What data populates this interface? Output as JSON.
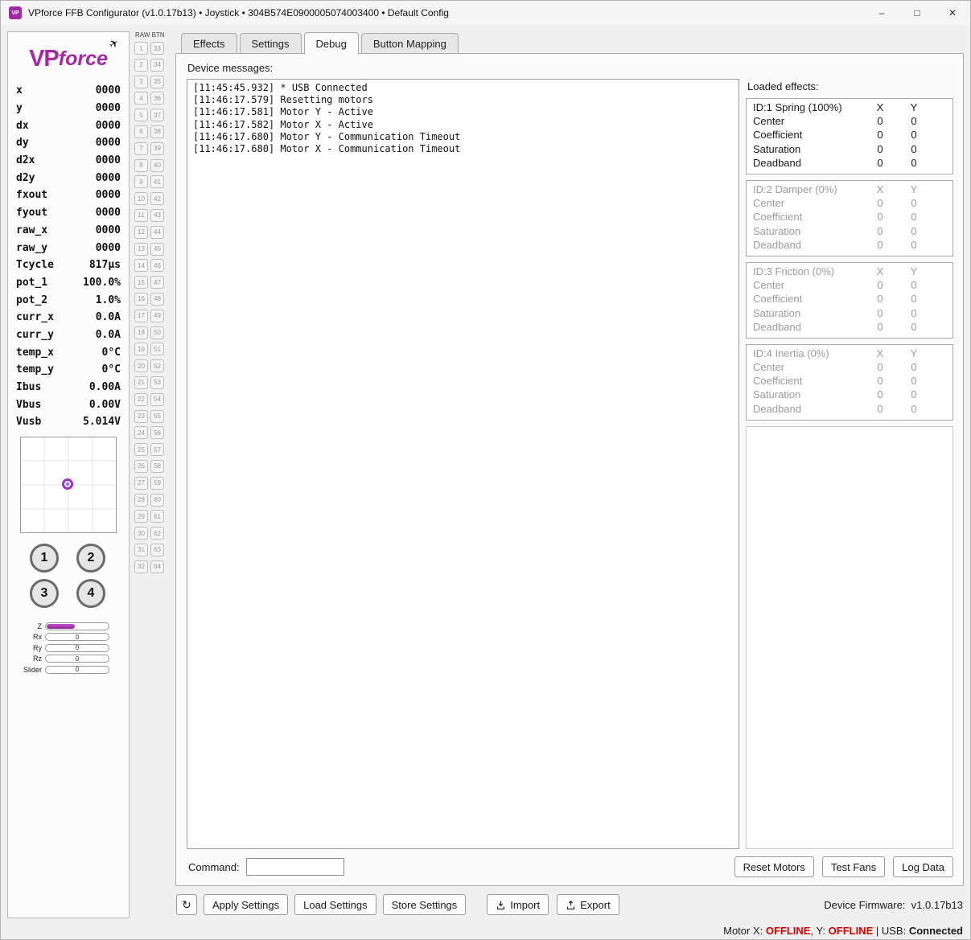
{
  "window": {
    "icon_text": "VP",
    "title": "VPforce FFB Configurator (v1.0.17b13) • Joystick • 304B574E0900005074003400 • Default Config",
    "controls": {
      "minimize": "–",
      "maximize": "□",
      "close": "✕"
    }
  },
  "sidebar": {
    "logo": {
      "vp": "VP",
      "force": "force",
      "plane": "✈"
    },
    "telemetry": [
      {
        "label": "x",
        "value": "0000"
      },
      {
        "label": "y",
        "value": "0000"
      },
      {
        "label": "dx",
        "value": "0000"
      },
      {
        "label": "dy",
        "value": "0000"
      },
      {
        "label": "d2x",
        "value": "0000"
      },
      {
        "label": "d2y",
        "value": "0000"
      },
      {
        "label": "fxout",
        "value": "0000"
      },
      {
        "label": "fyout",
        "value": "0000"
      },
      {
        "label": "raw_x",
        "value": "0000"
      },
      {
        "label": "raw_y",
        "value": "0000"
      },
      {
        "label": "Tcycle",
        "value": "817µs"
      },
      {
        "label": "pot_1",
        "value": "100.0%"
      },
      {
        "label": "pot_2",
        "value": "1.0%"
      },
      {
        "label": "curr_x",
        "value": "0.0A"
      },
      {
        "label": "curr_y",
        "value": "0.0A"
      },
      {
        "label": "temp_x",
        "value": "0°C"
      },
      {
        "label": "temp_y",
        "value": "0°C"
      },
      {
        "label": "Ibus",
        "value": "0.00A"
      },
      {
        "label": "Vbus",
        "value": "0.00V"
      },
      {
        "label": "Vusb",
        "value": "5.014V"
      }
    ],
    "hat_buttons": [
      "1",
      "2",
      "3",
      "4"
    ],
    "axes": [
      {
        "label": "Z",
        "value": "",
        "fill_percent": 45
      },
      {
        "label": "Rx",
        "value": "0",
        "fill_percent": 0
      },
      {
        "label": "Ry",
        "value": "0",
        "fill_percent": 0
      },
      {
        "label": "Rz",
        "value": "0",
        "fill_percent": 0
      },
      {
        "label": "Slider",
        "value": "0",
        "fill_percent": 0
      }
    ]
  },
  "raw_btn": {
    "header": "RAW BTN",
    "count": 64
  },
  "tabs": [
    {
      "label": "Effects",
      "active": false
    },
    {
      "label": "Settings",
      "active": false
    },
    {
      "label": "Debug",
      "active": true
    },
    {
      "label": "Button Mapping",
      "active": false
    }
  ],
  "debug": {
    "device_messages_label": "Device messages:",
    "messages": [
      "[11:45:45.932] * USB Connected",
      "[11:46:17.579] Resetting motors",
      "[11:46:17.581] Motor Y - Active",
      "[11:46:17.582] Motor X - Active",
      "[11:46:17.680] Motor Y - Communication Timeout",
      "[11:46:17.680] Motor X - Communication Timeout"
    ],
    "command_label": "Command:",
    "command_value": "",
    "loaded_effects_label": "Loaded effects:",
    "effect_columns": [
      "X",
      "Y"
    ],
    "effects": [
      {
        "title": "ID:1 Spring (100%)",
        "active": true,
        "rows": [
          {
            "name": "Center",
            "x": "0",
            "y": "0"
          },
          {
            "name": "Coefficient",
            "x": "0",
            "y": "0"
          },
          {
            "name": "Saturation",
            "x": "0",
            "y": "0"
          },
          {
            "name": "Deadband",
            "x": "0",
            "y": "0"
          }
        ]
      },
      {
        "title": "ID:2 Damper (0%)",
        "active": false,
        "rows": [
          {
            "name": "Center",
            "x": "0",
            "y": "0"
          },
          {
            "name": "Coefficient",
            "x": "0",
            "y": "0"
          },
          {
            "name": "Saturation",
            "x": "0",
            "y": "0"
          },
          {
            "name": "Deadband",
            "x": "0",
            "y": "0"
          }
        ]
      },
      {
        "title": "ID:3 Friction (0%)",
        "active": false,
        "rows": [
          {
            "name": "Center",
            "x": "0",
            "y": "0"
          },
          {
            "name": "Coefficient",
            "x": "0",
            "y": "0"
          },
          {
            "name": "Saturation",
            "x": "0",
            "y": "0"
          },
          {
            "name": "Deadband",
            "x": "0",
            "y": "0"
          }
        ]
      },
      {
        "title": "ID:4 Inertia (0%)",
        "active": false,
        "rows": [
          {
            "name": "Center",
            "x": "0",
            "y": "0"
          },
          {
            "name": "Coefficient",
            "x": "0",
            "y": "0"
          },
          {
            "name": "Saturation",
            "x": "0",
            "y": "0"
          },
          {
            "name": "Deadband",
            "x": "0",
            "y": "0"
          }
        ]
      }
    ],
    "action_buttons": [
      "Reset Motors",
      "Test Fans",
      "Log Data"
    ]
  },
  "bottom_bar": {
    "refresh_icon": "↻",
    "buttons": [
      "Apply Settings",
      "Load Settings",
      "Store Settings"
    ],
    "import_label": "Import",
    "export_label": "Export",
    "firmware_label": "Device Firmware:  ",
    "firmware_value": "v1.0.17b13"
  },
  "status_bar": {
    "motor_x_label": "Motor X: ",
    "motor_x_status": "OFFLINE",
    "y_label": ", Y: ",
    "y_status": "OFFLINE",
    "usb_label": " | USB: ",
    "usb_status": "Connected"
  },
  "colors": {
    "accent_magenta": "#a328a3",
    "offline_red": "#d10000"
  }
}
